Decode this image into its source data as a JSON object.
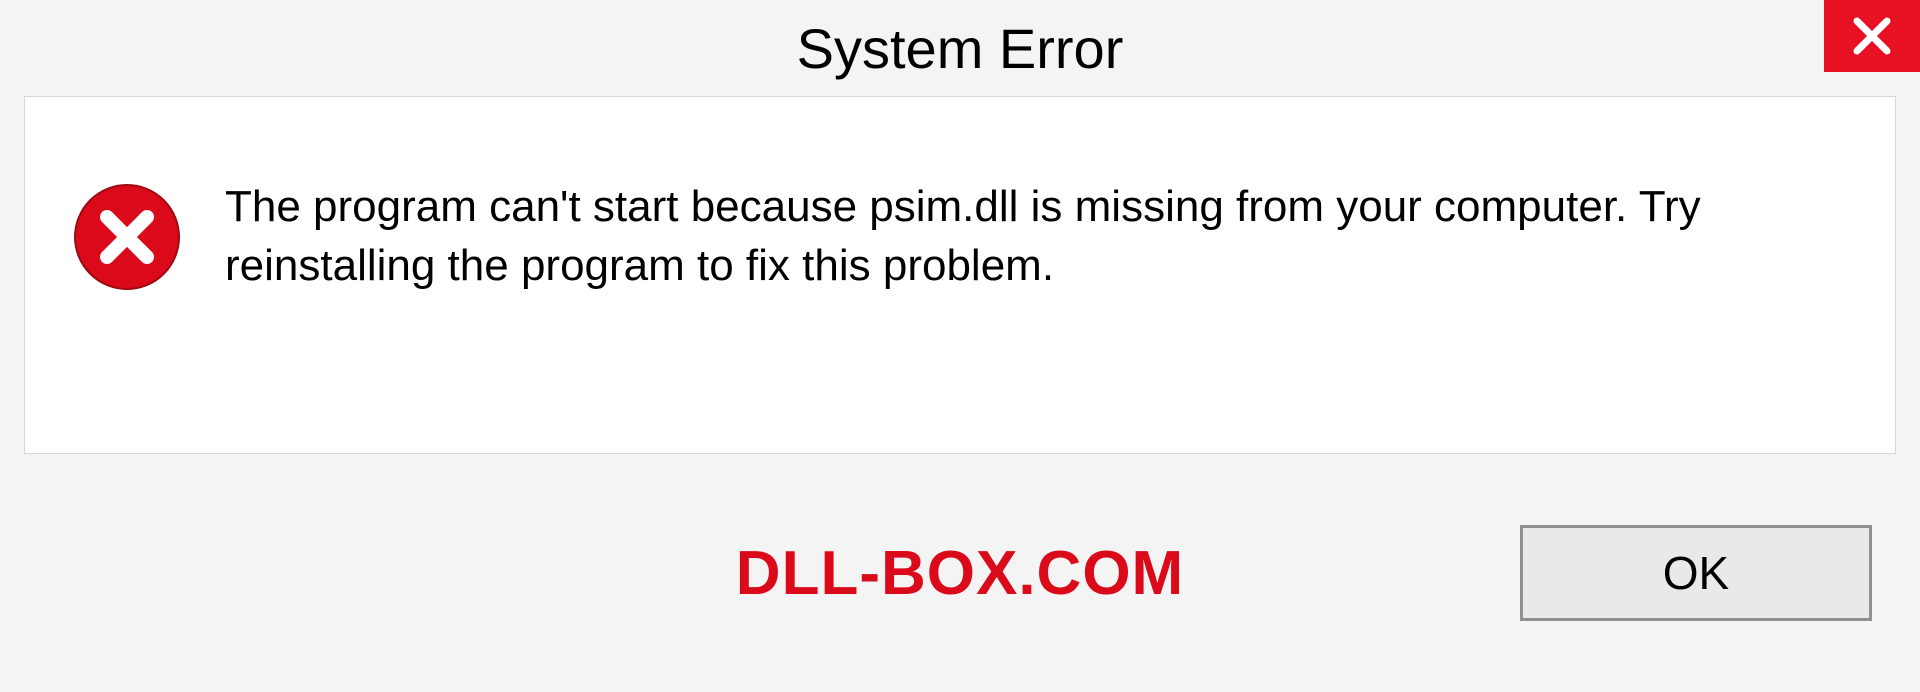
{
  "dialog": {
    "title": "System Error",
    "message": "The program can't start because psim.dll is missing from your computer. Try reinstalling the program to fix this problem.",
    "ok_label": "OK"
  },
  "watermark": "DLL-BOX.COM",
  "colors": {
    "close_button": "#e81123",
    "error_icon": "#db0a1a",
    "watermark": "#db0a1a"
  }
}
